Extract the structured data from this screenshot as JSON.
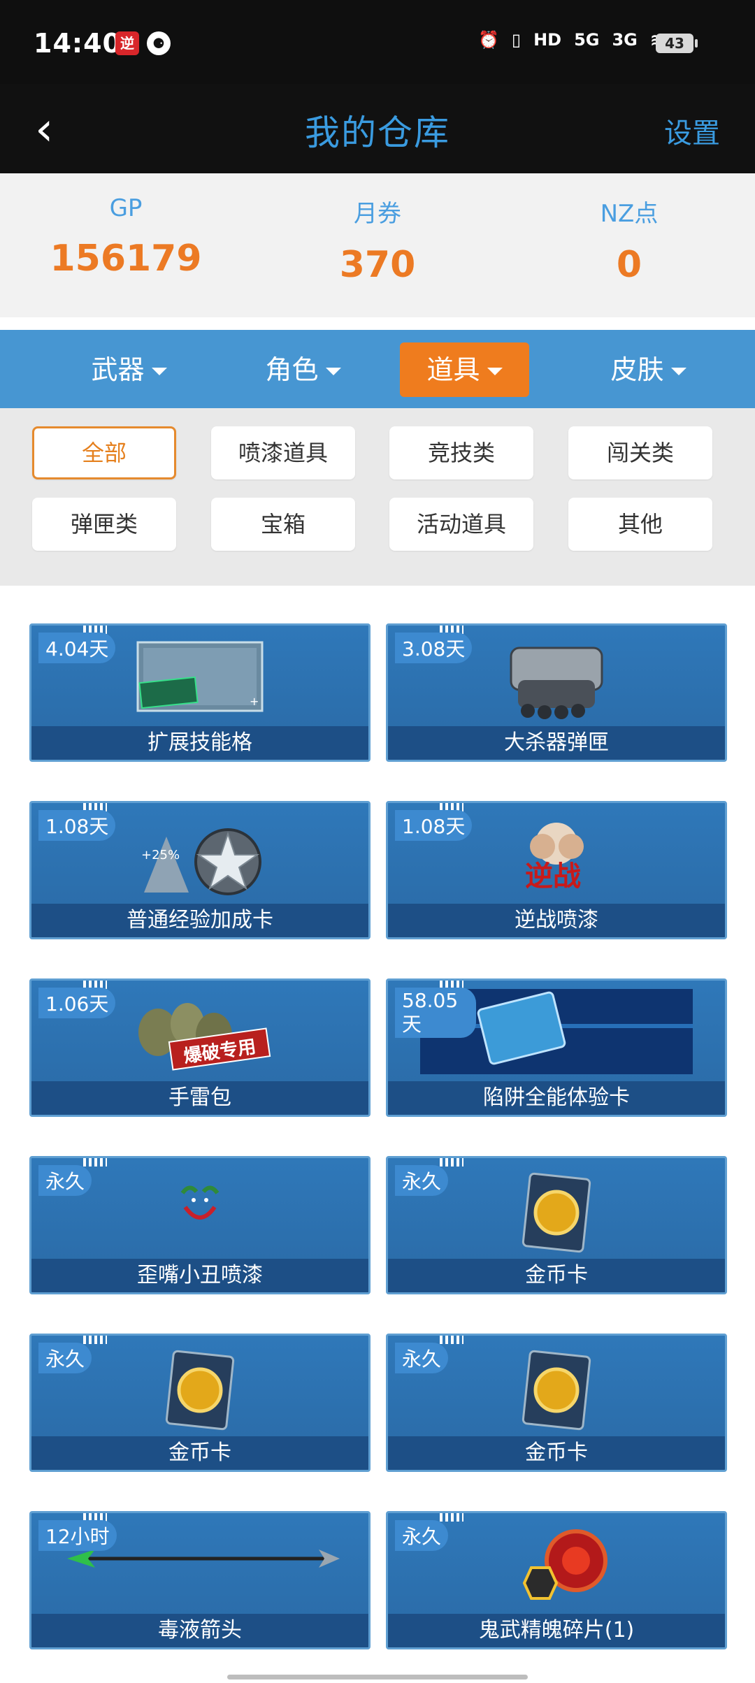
{
  "status_bar": {
    "time": "14:40",
    "app_icon_1": "逆",
    "app_icon_2": "⚈",
    "hd": "HD",
    "net1": "5G",
    "net2": "3G",
    "battery": "43"
  },
  "header": {
    "back_icon": "‹",
    "title": "我的仓库",
    "settings": "设置"
  },
  "currency": [
    {
      "label": "GP",
      "value": "156179"
    },
    {
      "label": "月券",
      "value": "370"
    },
    {
      "label": "NZ点",
      "value": "0"
    }
  ],
  "tabs": [
    {
      "label": "武器",
      "active": false
    },
    {
      "label": "角色",
      "active": false
    },
    {
      "label": "道具",
      "active": true
    },
    {
      "label": "皮肤",
      "active": false
    }
  ],
  "filters": [
    {
      "label": "全部",
      "active": true
    },
    {
      "label": "喷漆道具"
    },
    {
      "label": "竞技类"
    },
    {
      "label": "闯关类"
    },
    {
      "label": "弹匣类"
    },
    {
      "label": "宝箱"
    },
    {
      "label": "活动道具"
    },
    {
      "label": "其他"
    }
  ],
  "items": [
    {
      "name": "扩展技能格",
      "duration": "4.04天",
      "icon": "skill-slot-icon"
    },
    {
      "name": "大杀器弹匣",
      "duration": "3.08天",
      "icon": "magazine-icon"
    },
    {
      "name": "普通经验加成卡",
      "duration": "1.08天",
      "icon": "star-badge-icon",
      "art_text": "+25%"
    },
    {
      "name": "逆战喷漆",
      "duration": "1.08天",
      "icon": "spray-icon",
      "art_text": "逆战"
    },
    {
      "name": "手雷包",
      "duration": "1.06天",
      "icon": "grenade-icon",
      "art_text": "爆破专用"
    },
    {
      "name": "陷阱全能体验卡",
      "duration": "58.05天",
      "icon": "trap-card-icon"
    },
    {
      "name": "歪嘴小丑喷漆",
      "duration": "永久",
      "icon": "joker-icon"
    },
    {
      "name": "金币卡",
      "duration": "永久",
      "icon": "gold-coin-icon"
    },
    {
      "name": "金币卡",
      "duration": "永久",
      "icon": "gold-coin-icon"
    },
    {
      "name": "金币卡",
      "duration": "永久",
      "icon": "gold-coin-icon"
    },
    {
      "name": "毒液箭头",
      "duration": "12小时",
      "icon": "arrow-icon"
    },
    {
      "name": "鬼武精魄碎片(1)",
      "duration": "永久",
      "icon": "puzzle-shard-icon"
    }
  ],
  "colors": {
    "accent_blue": "#3a9be0",
    "accent_orange": "#ef7c1e",
    "card_blue": "#2f78b9"
  }
}
